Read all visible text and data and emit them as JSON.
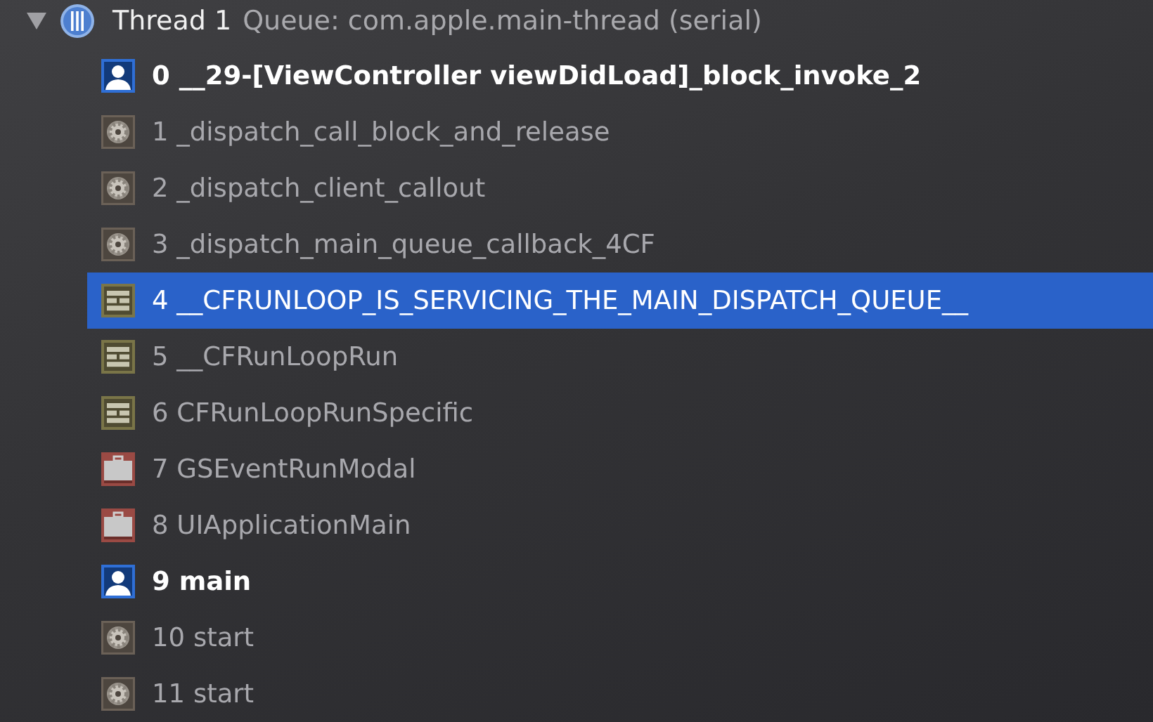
{
  "thread": {
    "name": "Thread 1",
    "queue": "Queue: com.apple.main-thread (serial)",
    "expanded": true
  },
  "frames": [
    {
      "index": "0",
      "symbol": "__29-[ViewController viewDidLoad]_block_invoke_2",
      "kind": "user",
      "selected": false
    },
    {
      "index": "1",
      "symbol": "_dispatch_call_block_and_release",
      "kind": "system",
      "selected": false
    },
    {
      "index": "2",
      "symbol": "_dispatch_client_callout",
      "kind": "system",
      "selected": false
    },
    {
      "index": "3",
      "symbol": "_dispatch_main_queue_callback_4CF",
      "kind": "system",
      "selected": false
    },
    {
      "index": "4",
      "symbol": "__CFRUNLOOP_IS_SERVICING_THE_MAIN_DISPATCH_QUEUE__",
      "kind": "framework",
      "selected": true
    },
    {
      "index": "5",
      "symbol": "__CFRunLoopRun",
      "kind": "framework",
      "selected": false
    },
    {
      "index": "6",
      "symbol": "CFRunLoopRunSpecific",
      "kind": "framework",
      "selected": false
    },
    {
      "index": "7",
      "symbol": "GSEventRunModal",
      "kind": "app",
      "selected": false
    },
    {
      "index": "8",
      "symbol": "UIApplicationMain",
      "kind": "app",
      "selected": false
    },
    {
      "index": "9",
      "symbol": "main",
      "kind": "user",
      "selected": false
    },
    {
      "index": "10",
      "symbol": "start",
      "kind": "system",
      "selected": false
    },
    {
      "index": "11",
      "symbol": "start",
      "kind": "system",
      "selected": false
    }
  ]
}
